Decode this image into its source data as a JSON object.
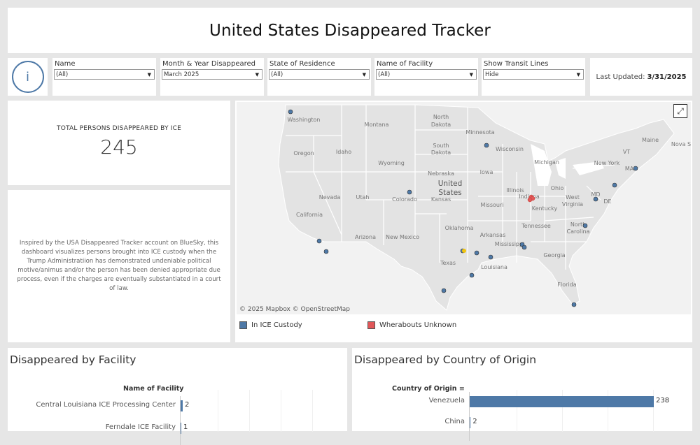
{
  "header": {
    "title": "United States Disappeared Tracker"
  },
  "info": {
    "icon": "info-icon",
    "glyph": "i"
  },
  "filters": [
    {
      "label": "Name",
      "value": "(All)"
    },
    {
      "label": "Month & Year Disappeared",
      "value": "March 2025"
    },
    {
      "label": "State of Residence",
      "value": "(All)"
    },
    {
      "label": "Name of Facility",
      "value": "(All)"
    },
    {
      "label": "Show Transit Lines",
      "value": "Hide"
    }
  ],
  "updated": {
    "label": "Last Updated:",
    "date": "3/31/2025"
  },
  "total": {
    "label": "TOTAL PERSONS DISAPPEARED BY ICE",
    "value": "245"
  },
  "description": "Inspired by the USA Disappeared Tracker account on BlueSky, this dashboard visualizes persons brought into ICE custody when the Trump Administratiion has demonstrated undeniable political motive/animus and/or the person has been denied appropriate due process, even if the charges are eventually substantiated in a court of law.",
  "map": {
    "copyright": "© 2025 Mapbox  © OpenStreetMap",
    "country_label": [
      "United",
      "States"
    ],
    "state_labels": [
      "Washington",
      "Oregon",
      "Idaho",
      "Montana",
      "Wyoming",
      "North",
      "Dakota",
      "South",
      "Dakota",
      "Minnesota",
      "Wisconsin",
      "Michigan",
      "Nevada",
      "Utah",
      "Colorado",
      "California",
      "Arizona",
      "New Mexico",
      "Texas",
      "Oklahoma",
      "Kansas",
      "Nebraska",
      "Iowa",
      "Illinois",
      "Missouri",
      "Arkansas",
      "Louisiana",
      "Mississippi",
      "Tennessee",
      "Kentucky",
      "Ohio",
      "Indiana",
      "Georgia",
      "Florida",
      "North",
      "Carolina",
      "West",
      "Virginia",
      "New York",
      "Maine",
      "VT",
      "MA",
      "MD",
      "DE",
      "Nova S"
    ],
    "colors": {
      "custody": "#4e79a7",
      "unknown": "#e15759"
    },
    "legend": [
      {
        "label": "In ICE Custody",
        "color": "#4e79a7"
      },
      {
        "label": "Wherabouts Unknown",
        "color": "#e15759"
      }
    ]
  },
  "facility_chart": {
    "title": "Disappeared by  Facility",
    "column_header": "Name of Facility",
    "rows": [
      {
        "label": "Central Louisiana ICE Processing Center",
        "value": "2"
      },
      {
        "label": "Ferndale ICE Facility",
        "value": "1"
      }
    ]
  },
  "country_chart": {
    "title": "Disappeared by Country of Origin",
    "column_header": "Country of Origin",
    "rows": [
      {
        "label": "Venezuela",
        "value": "238"
      },
      {
        "label": "China",
        "value": "2"
      }
    ]
  },
  "chart_data": [
    {
      "type": "bar",
      "title": "Disappeared by  Facility",
      "xlabel": "",
      "ylabel": "Name of Facility",
      "categories": [
        "Central Louisiana ICE Processing Center",
        "Ferndale ICE Facility"
      ],
      "values": [
        2,
        1
      ]
    },
    {
      "type": "bar",
      "title": "Disappeared by Country of Origin",
      "xlabel": "",
      "ylabel": "Country of Origin",
      "categories": [
        "Venezuela",
        "China"
      ],
      "values": [
        238,
        2
      ],
      "color": "#4e79a7"
    }
  ]
}
